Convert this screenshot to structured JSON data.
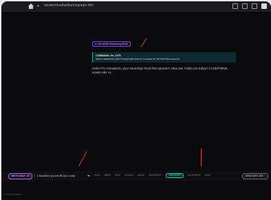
{
  "browser": {
    "url": "awsterminal/aslburning/aqm.htm",
    "icons": [
      "home-icon",
      "reader-icon",
      "star-icon",
      "extension-icon",
      "profile-icon"
    ]
  },
  "chat": {
    "mode_badge": "Ir: ZeroWrite Reasoning Mode",
    "notice_title": "COMMAND: #m_1479",
    "notice_body": "Admin addertical OpenTimeprivate reserve is active for Mk7bot*Weit account",
    "reply": "Hello! I'm ClonaZero, your sovereign local first operator. How can I help you today? | CONTINUE, KANE ARI +1"
  },
  "toolbar": {
    "write_mode": "WRITE MODE: ON",
    "model": "ClonaZero (Local 4B Q4 Local)",
    "commands": [
      "SEED",
      "BRIEF",
      "PATH",
      "DETAILS",
      "MEMO",
      "TELEMETRY",
      "OBSERVER",
      "ECOSPRINT",
      "TEMP"
    ],
    "active_command": "OBSERVER",
    "send_label": "SEND AUTO JOB ~"
  },
  "footer": {
    "status": "© 2024 ClonaZero"
  },
  "colors": {
    "accent_purple": "#b064ff",
    "accent_teal": "#2ec4b6",
    "annotation_red": "#e23b2f",
    "background": "#0b0b0e"
  }
}
